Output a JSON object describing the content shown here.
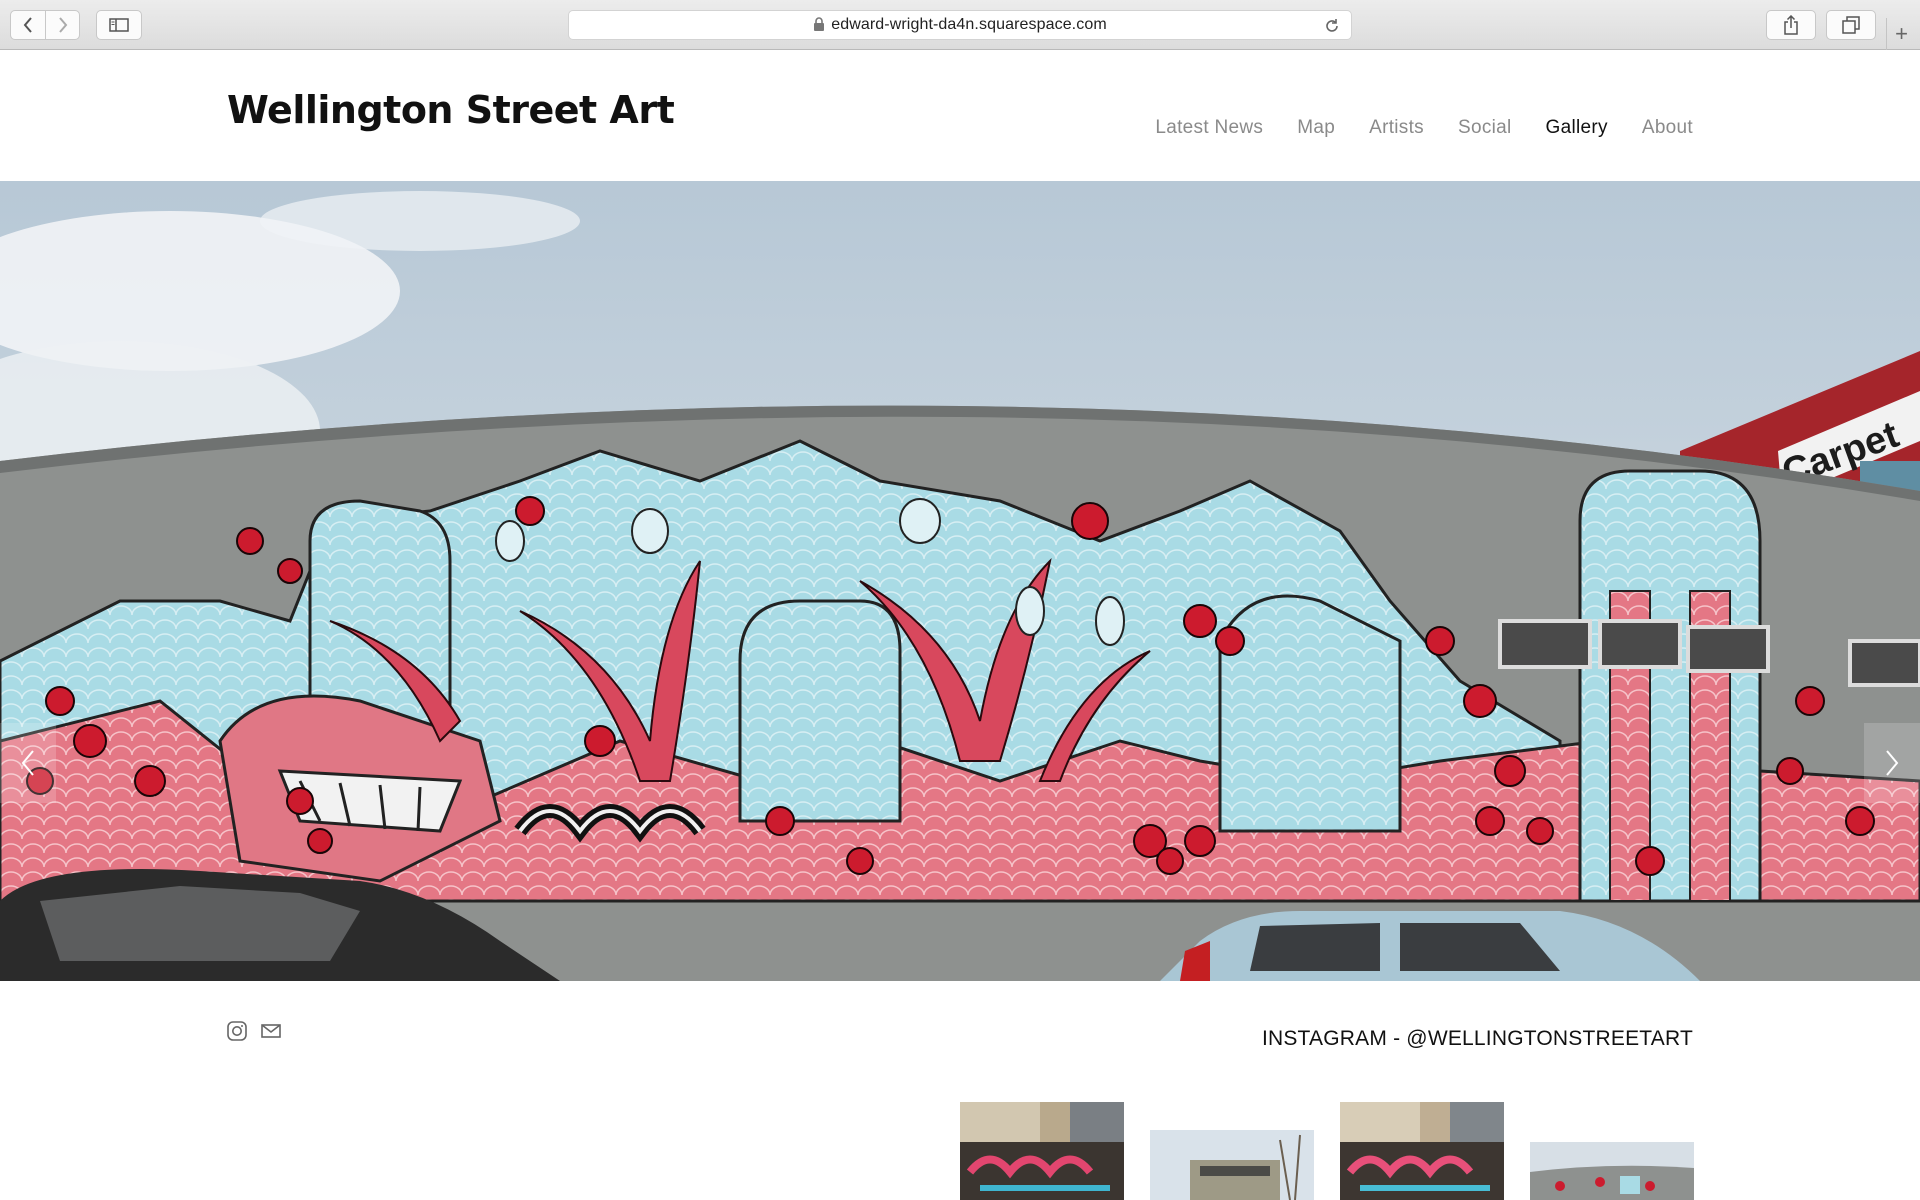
{
  "browser": {
    "url": "edward-wright-da4n.squarespace.com",
    "icons": [
      "back-icon",
      "forward-icon",
      "sidebar-icon",
      "lock-icon",
      "reload-icon",
      "share-icon",
      "tabs-icon",
      "plus-icon"
    ],
    "new_tab_glyph": "+"
  },
  "site": {
    "title": "Wellington Street Art",
    "nav": [
      {
        "label": "Latest News",
        "active": false
      },
      {
        "label": "Map",
        "active": false
      },
      {
        "label": "Artists",
        "active": false
      },
      {
        "label": "Social",
        "active": false
      },
      {
        "label": "Gallery",
        "active": true
      },
      {
        "label": "About",
        "active": false
      }
    ]
  },
  "hero": {
    "building_sign": "Carpet",
    "prev_icon": "chevron-left-icon",
    "next_icon": "chevron-right-icon"
  },
  "footer": {
    "social_icons": [
      "instagram-icon",
      "mail-icon"
    ],
    "instagram_heading": "INSTAGRAM - @WELLINGTONSTREETART",
    "thumbnail_count": 4
  },
  "colors": {
    "text_dark": "#111111",
    "nav_muted": "#8a8a8a",
    "mural_red": "#d8213a",
    "mural_pink": "#e0707f",
    "mural_blue": "#a8d8e2",
    "wall_grey": "#8e918f",
    "sky": "#c9d6e0"
  }
}
